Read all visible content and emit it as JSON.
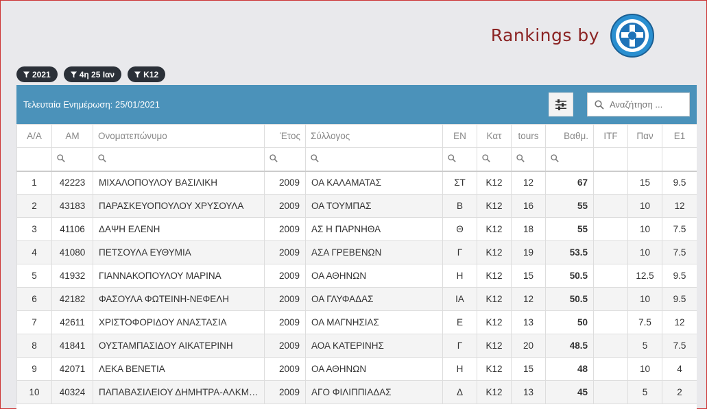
{
  "brand": {
    "text": "Rankings by"
  },
  "filters": [
    "2021",
    "4η 25 Ιαν",
    "Κ12"
  ],
  "toolbar": {
    "update_text": "Τελευταία Ενημέρωση: 25/01/2021",
    "search_placeholder": "Αναζήτηση ..."
  },
  "columns": [
    "Α/Α",
    "ΑΜ",
    "Ονοματεπώνυμο",
    "Έτος",
    "Σύλλογος",
    "ΕΝ",
    "Κατ",
    "tours",
    "Βαθμ.",
    "ITF",
    "Παν",
    "Ε1"
  ],
  "rows": [
    [
      "1",
      "42223",
      "ΜΙΧΑΛΟΠΟΥΛΟΥ ΒΑΣΙΛΙΚΗ",
      "2009",
      "ΟΑ ΚΑΛΑΜΑΤΑΣ",
      "ΣΤ",
      "Κ12",
      "12",
      "67",
      "",
      "15",
      "9.5"
    ],
    [
      "2",
      "43183",
      "ΠΑΡΑΣΚΕΥΟΠΟΥΛΟΥ ΧΡΥΣΟΥΛΑ",
      "2009",
      "ΟΑ ΤΟΥΜΠΑΣ",
      "Β",
      "Κ12",
      "16",
      "55",
      "",
      "10",
      "12"
    ],
    [
      "3",
      "41106",
      "ΔΑΨΗ ΕΛΕΝΗ",
      "2009",
      "ΑΣ Η ΠΑΡΝΗΘΑ",
      "Θ",
      "Κ12",
      "18",
      "55",
      "",
      "10",
      "7.5"
    ],
    [
      "4",
      "41080",
      "ΠΕΤΣΟΥΛΑ ΕΥΘΥΜΙΑ",
      "2009",
      "ΑΣΑ ΓΡΕΒΕΝΩΝ",
      "Γ",
      "Κ12",
      "19",
      "53.5",
      "",
      "10",
      "7.5"
    ],
    [
      "5",
      "41932",
      "ΓΙΑΝΝΑΚΟΠΟΥΛΟΥ ΜΑΡΙΝΑ",
      "2009",
      "ΟΑ ΑΘΗΝΩΝ",
      "Η",
      "Κ12",
      "15",
      "50.5",
      "",
      "12.5",
      "9.5"
    ],
    [
      "6",
      "42182",
      "ΦΑΣΟΥΛΑ ΦΩΤΕΙΝΗ-ΝΕΦΕΛΗ",
      "2009",
      "ΟΑ ΓΛΥΦΑΔΑΣ",
      "ΙΑ",
      "Κ12",
      "12",
      "50.5",
      "",
      "10",
      "9.5"
    ],
    [
      "7",
      "42611",
      "ΧΡΙΣΤΟΦΟΡΙΔΟΥ ΑΝΑΣΤΑΣΙΑ",
      "2009",
      "ΟΑ ΜΑΓΝΗΣΙΑΣ",
      "Ε",
      "Κ12",
      "13",
      "50",
      "",
      "7.5",
      "12"
    ],
    [
      "8",
      "41841",
      "ΟΥΣΤΑΜΠΑΣΙΔΟΥ ΑΙΚΑΤΕΡΙΝΗ",
      "2009",
      "ΑΟΑ ΚΑΤΕΡΙΝΗΣ",
      "Γ",
      "Κ12",
      "20",
      "48.5",
      "",
      "5",
      "7.5"
    ],
    [
      "9",
      "42071",
      "ΛΕΚΑ ΒΕΝΕΤΙΑ",
      "2009",
      "ΟΑ ΑΘΗΝΩΝ",
      "Η",
      "Κ12",
      "15",
      "48",
      "",
      "10",
      "4"
    ],
    [
      "10",
      "40324",
      "ΠΑΠΑΒΑΣΙΛΕΙΟΥ ΔΗΜΗΤΡΑ-ΑΛΚΜΗΝΗ",
      "2009",
      "ΑΓΟ ΦΙΛΙΠΠΙΑΔΑΣ",
      "Δ",
      "Κ12",
      "13",
      "45",
      "",
      "5",
      "2"
    ]
  ]
}
